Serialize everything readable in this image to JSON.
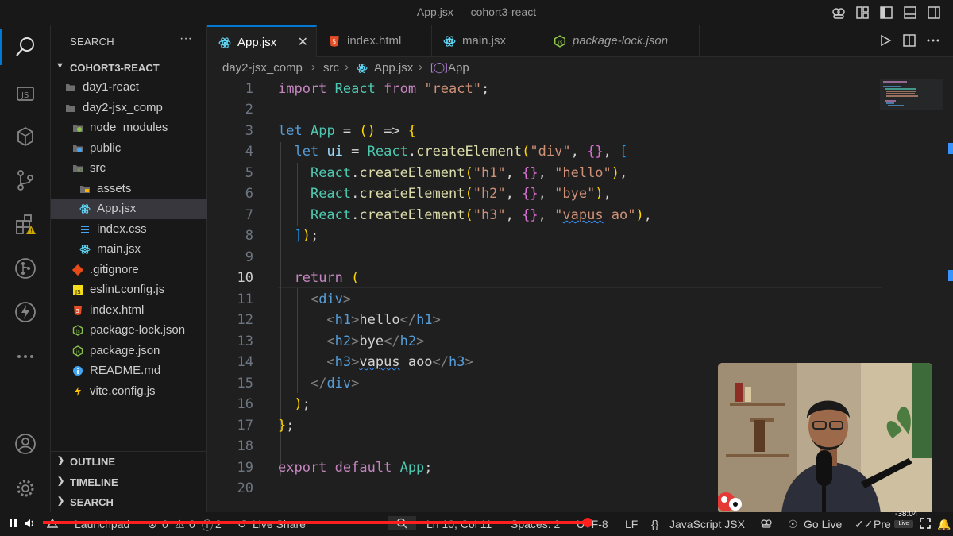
{
  "window": {
    "title": "App.jsx — cohort3-react"
  },
  "sidebar": {
    "heading": "SEARCH",
    "more": "···",
    "root": "COHORT3-REACT",
    "items": [
      {
        "label": "day1-react",
        "icon": "folder-icon"
      },
      {
        "label": "day2-jsx_comp",
        "icon": "folder-open-icon"
      },
      {
        "label": "node_modules",
        "icon": "folder-node-icon"
      },
      {
        "label": "public",
        "icon": "folder-public-icon"
      },
      {
        "label": "src",
        "icon": "folder-src-icon"
      },
      {
        "label": "assets",
        "icon": "folder-assets-icon"
      },
      {
        "label": "App.jsx",
        "icon": "react-icon"
      },
      {
        "label": "index.css",
        "icon": "css-icon"
      },
      {
        "label": "main.jsx",
        "icon": "react-icon"
      },
      {
        "label": ".gitignore",
        "icon": "git-icon"
      },
      {
        "label": "eslint.config.js",
        "icon": "js-icon"
      },
      {
        "label": "index.html",
        "icon": "html-icon"
      },
      {
        "label": "package-lock.json",
        "icon": "nodejs-icon"
      },
      {
        "label": "package.json",
        "icon": "nodejs-icon"
      },
      {
        "label": "README.md",
        "icon": "info-icon"
      },
      {
        "label": "vite.config.js",
        "icon": "vite-icon"
      }
    ],
    "sections": [
      "OUTLINE",
      "TIMELINE",
      "SEARCH"
    ]
  },
  "tabs": [
    {
      "label": "App.jsx",
      "icon": "react-icon",
      "active": true
    },
    {
      "label": "index.html",
      "icon": "html-icon"
    },
    {
      "label": "main.jsx",
      "icon": "react-icon"
    },
    {
      "label": "package-lock.json",
      "icon": "nodejs-icon"
    }
  ],
  "breadcrumb": [
    "day2-jsx_comp",
    "src",
    "App.jsx",
    "App"
  ],
  "editor": {
    "line_numbers": [
      "1",
      "2",
      "3",
      "4",
      "5",
      "6",
      "7",
      "8",
      "9",
      "10",
      "11",
      "12",
      "13",
      "14",
      "15",
      "16",
      "17",
      "18",
      "19",
      "20"
    ],
    "current_line": "10",
    "code_text": [
      "import React from \"react\";",
      "",
      "let App = () => {",
      "  let ui = React.createElement(\"div\", {}, [",
      "    React.createElement(\"h1\", {}, \"hello\"),",
      "    React.createElement(\"h2\", {}, \"bye\"),",
      "    React.createElement(\"h3\", {}, \"vapus ao\"),",
      "  ]);",
      "",
      "  return (",
      "    <div>",
      "      <h1>hello</h1>",
      "      <h2>bye</h2>",
      "      <h3>vapus aoo</h3>",
      "    </div>",
      "  );",
      "};",
      "",
      "export default App;",
      ""
    ]
  },
  "status": {
    "launchpad": "Launchpad",
    "errors": "0",
    "warnings": "0",
    "info": "2",
    "live_share": "Live Share",
    "cursor": "Ln 10, Col 11",
    "spaces": "Spaces: 2",
    "encoding": "UTF-8",
    "eol": "LF",
    "language": "JavaScript JSX",
    "go_live": "Go Live",
    "prettier": "Pre"
  },
  "player": {
    "time": "-38:04",
    "live": "Live",
    "progress": 0.62
  },
  "colors": {
    "accent": "#0078d4",
    "progress": "#ff1f1f",
    "warning": "#cca700"
  }
}
